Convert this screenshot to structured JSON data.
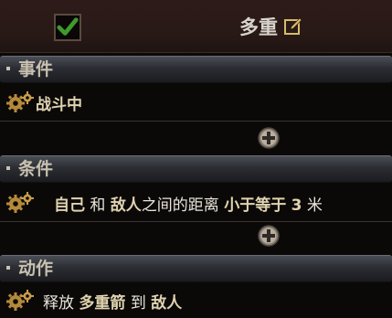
{
  "header": {
    "enabled": true,
    "title": "多重",
    "edit_icon": "edit-icon",
    "checkbox_color": "#3f9a2c"
  },
  "sections": {
    "event": {
      "label": "事件",
      "rows": [
        {
          "text": "战斗中"
        }
      ]
    },
    "condition": {
      "label": "条件",
      "rows": [
        {
          "parts": [
            "自己",
            "和",
            "敌人",
            "之间的距离",
            "小于等于",
            "3",
            "米"
          ]
        }
      ]
    },
    "action": {
      "label": "动作",
      "rows": [
        {
          "parts": [
            "释放",
            "多重箭",
            "到",
            "敌人"
          ]
        }
      ]
    }
  },
  "icons": {
    "gear": "gears-icon",
    "add": "add-circle-icon"
  }
}
